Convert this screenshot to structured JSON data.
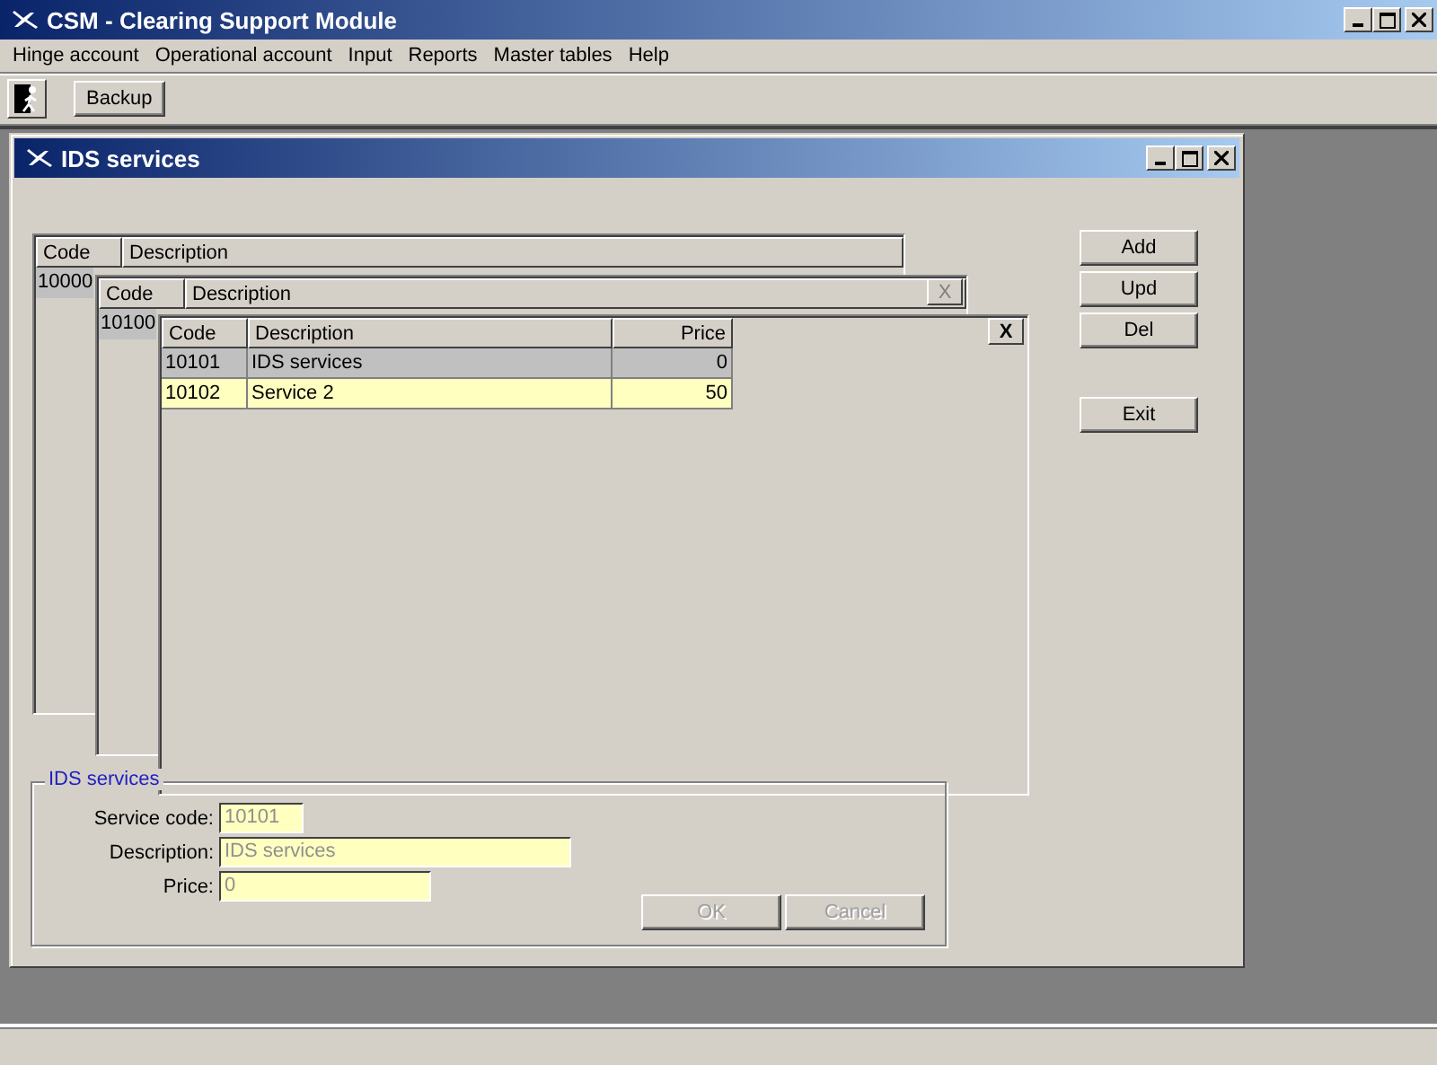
{
  "app_window": {
    "title": "CSM - Clearing Support Module"
  },
  "menu": [
    "Hinge account",
    "Operational account",
    "Input",
    "Reports",
    "Master tables",
    "Help"
  ],
  "toolbar": {
    "backup_button": "Backup"
  },
  "child_window": {
    "title": "IDS services",
    "grids": [
      {
        "columns": [
          "Code",
          "Description"
        ],
        "rows": [
          {
            "cells": [
              "10000"
            ],
            "selected": true
          }
        ]
      },
      {
        "columns": [
          "Code",
          "Description"
        ],
        "rows": [
          {
            "cells": [
              "10100"
            ],
            "selected": true
          }
        ],
        "close_button": {
          "label": "X",
          "disabled": true
        }
      },
      {
        "columns": [
          "Code",
          "Description",
          "Price"
        ],
        "rows": [
          {
            "cells": [
              "10101",
              "IDS services",
              "0"
            ],
            "selected": true
          },
          {
            "cells": [
              "10102",
              "Service 2",
              "50"
            ],
            "selected": false
          }
        ],
        "close_button": {
          "label": "X",
          "disabled": false
        }
      }
    ],
    "buttons": [
      "Add",
      "Upd",
      "Del",
      "Exit"
    ],
    "group": {
      "title": "IDS services",
      "fields": [
        {
          "label": "Service code:",
          "value": "10101",
          "disabled": true
        },
        {
          "label": "Description:",
          "value": "IDS services",
          "disabled": true
        },
        {
          "label": "Price:",
          "value": "0",
          "disabled": true
        }
      ],
      "buttons": [
        {
          "label": "OK",
          "disabled": true
        },
        {
          "label": "Cancel",
          "disabled": true
        }
      ]
    }
  }
}
